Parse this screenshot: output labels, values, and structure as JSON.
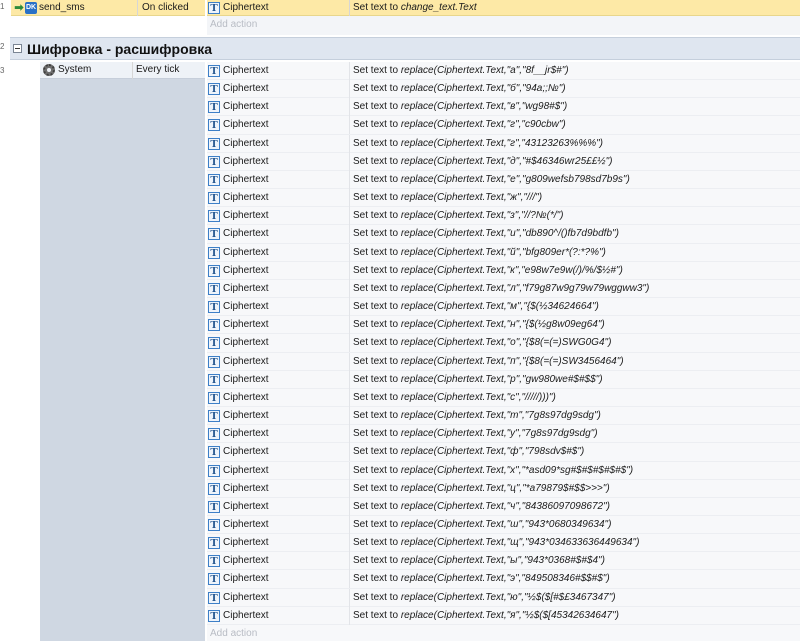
{
  "line_numbers": [
    "1",
    "2",
    "3"
  ],
  "event1": {
    "object": "send_sms",
    "object_icon_text": "DK",
    "condition": "On clicked",
    "action": {
      "object": "Ciphertext",
      "prefix": "Set text to ",
      "expression": "change_text.Text"
    },
    "add_action": "Add action"
  },
  "group": {
    "title": "Шифровка - расшифровка"
  },
  "event3": {
    "object": "System",
    "condition": "Every tick",
    "add_action": "Add action",
    "action_prefix": "Set text to ",
    "actions": [
      {
        "object": "Ciphertext",
        "expression": "replace(Ciphertext.Text,\"а\",\"8f__jr$#\")"
      },
      {
        "object": "Ciphertext",
        "expression": "replace(Ciphertext.Text,\"б\",\"94а;;№\")"
      },
      {
        "object": "Ciphertext",
        "expression": "replace(Ciphertext.Text,\"в\",\"wg98#$\")"
      },
      {
        "object": "Ciphertext",
        "expression": "replace(Ciphertext.Text,\"г\",\"с90cbw\")"
      },
      {
        "object": "Ciphertext",
        "expression": "replace(Ciphertext.Text,\"г\",\"43123263%%%\")"
      },
      {
        "object": "Ciphertext",
        "expression": "replace(Ciphertext.Text,\"д\",\"#$46346wr25££½\")"
      },
      {
        "object": "Ciphertext",
        "expression": "replace(Ciphertext.Text,\"е\",\"g809wefsb798sd7b9s\")"
      },
      {
        "object": "Ciphertext",
        "expression": "replace(Ciphertext.Text,\"ж\",\"///\")"
      },
      {
        "object": "Ciphertext",
        "expression": "replace(Ciphertext.Text,\"з\",\"//?№(*/\")"
      },
      {
        "object": "Ciphertext",
        "expression": "replace(Ciphertext.Text,\"и\",\"db890^/()fb7d9bdfb\")"
      },
      {
        "object": "Ciphertext",
        "expression": "replace(Ciphertext.Text,\"й\",\"bfg809er*(?:*?%\")"
      },
      {
        "object": "Ciphertext",
        "expression": "replace(Ciphertext.Text,\"к\",\"e98w7e9w(/)/%/$½#\")"
      },
      {
        "object": "Ciphertext",
        "expression": "replace(Ciphertext.Text,\"л\",\"f79g87w9g79w79wggww3\")"
      },
      {
        "object": "Ciphertext",
        "expression": "replace(Ciphertext.Text,\"м\",\"{$(½34624664\")"
      },
      {
        "object": "Ciphertext",
        "expression": "replace(Ciphertext.Text,\"н\",\"{$(½g8w09eg64\")"
      },
      {
        "object": "Ciphertext",
        "expression": "replace(Ciphertext.Text,\"о\",\"{$8(=(=)SWG0G4\")"
      },
      {
        "object": "Ciphertext",
        "expression": "replace(Ciphertext.Text,\"п\",\"{$8(=(=)SW3456464\")"
      },
      {
        "object": "Ciphertext",
        "expression": "replace(Ciphertext.Text,\"р\",\"gw980we#$#$$\")"
      },
      {
        "object": "Ciphertext",
        "expression": "replace(Ciphertext.Text,\"с\",\"/////)))\")"
      },
      {
        "object": "Ciphertext",
        "expression": "replace(Ciphertext.Text,\"т\",\"7g8s97dg9sdg\")"
      },
      {
        "object": "Ciphertext",
        "expression": "replace(Ciphertext.Text,\"у\",\"7g8s97dg9sdg\")"
      },
      {
        "object": "Ciphertext",
        "expression": "replace(Ciphertext.Text,\"ф\",\"798sdv$#$\")"
      },
      {
        "object": "Ciphertext",
        "expression": "replace(Ciphertext.Text,\"х\",\"*asd09*sg#$#$#$#$#$\")"
      },
      {
        "object": "Ciphertext",
        "expression": "replace(Ciphertext.Text,\"ц\",\"*a79879$#$$>>>\")"
      },
      {
        "object": "Ciphertext",
        "expression": "replace(Ciphertext.Text,\"ч\",\"84386097098672\")"
      },
      {
        "object": "Ciphertext",
        "expression": "replace(Ciphertext.Text,\"ш\",\"943*0680349634\")"
      },
      {
        "object": "Ciphertext",
        "expression": "replace(Ciphertext.Text,\"щ\",\"943*034633636449634\")"
      },
      {
        "object": "Ciphertext",
        "expression": "replace(Ciphertext.Text,\"ы\",\"943*0368#$#$4\")"
      },
      {
        "object": "Ciphertext",
        "expression": "replace(Ciphertext.Text,\"э\",\"849508346#$$#$\")"
      },
      {
        "object": "Ciphertext",
        "expression": "replace(Ciphertext.Text,\"ю\",\"½$($[#$£3467347\")"
      },
      {
        "object": "Ciphertext",
        "expression": "replace(Ciphertext.Text,\"я\",\"½$($[45342634647\")"
      }
    ]
  },
  "icons": {
    "trigger": "green-arrow-icon",
    "object_button": "dk-button-icon",
    "text_object": "text-object-icon",
    "system": "gear-icon",
    "group_toggle": "collapse-minus-icon"
  },
  "colors": {
    "selected_row": "#fde9a6",
    "group_header": "#dfe6f0",
    "condition_column": "#cfd7e2",
    "add_action_text": "#b8bcc4"
  }
}
